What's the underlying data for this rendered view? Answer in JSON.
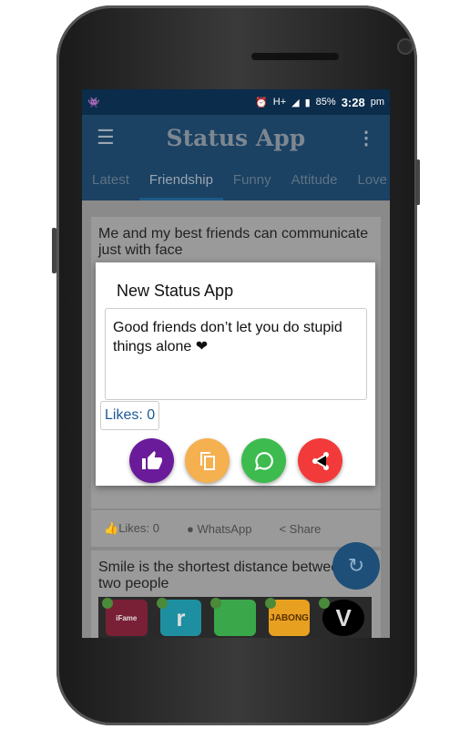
{
  "status_bar": {
    "battery": "85%",
    "time": "3:28",
    "ampm": "pm",
    "network": "H+"
  },
  "toolbar": {
    "title": "Status App"
  },
  "tabs": [
    {
      "label": "Latest"
    },
    {
      "label": "Friendship",
      "active": true
    },
    {
      "label": "Funny"
    },
    {
      "label": "Attitude"
    },
    {
      "label": "Love"
    }
  ],
  "cards": [
    {
      "text": "Me and my best friends can communicate just with face"
    },
    {
      "text": "Smile is the shortest distance between two people"
    }
  ],
  "card_actions": {
    "likes": "Likes: 0",
    "whatsapp": "WhatsApp",
    "share": "Share"
  },
  "dialog": {
    "title": "New Status App",
    "status_text": "Good friends don’t let you do stupid things alone ❤",
    "likes": "Likes: 0",
    "buttons": [
      {
        "icon": "thumbs-up-icon",
        "color": "#6a1b9a"
      },
      {
        "icon": "copy-icon",
        "color": "#f5b04f"
      },
      {
        "icon": "whatsapp-icon",
        "color": "#3dbb4f"
      },
      {
        "icon": "share-icon",
        "color": "#f23a3a"
      }
    ]
  },
  "ads": [
    {
      "label": "iFame",
      "color": "#7a2036"
    },
    {
      "label": "r",
      "color": "#1e8fa0"
    },
    {
      "label": "",
      "color": "#3aa84a"
    },
    {
      "label": "JABONG",
      "color": "#e8a020"
    },
    {
      "label": "V",
      "color": "#000000"
    }
  ]
}
